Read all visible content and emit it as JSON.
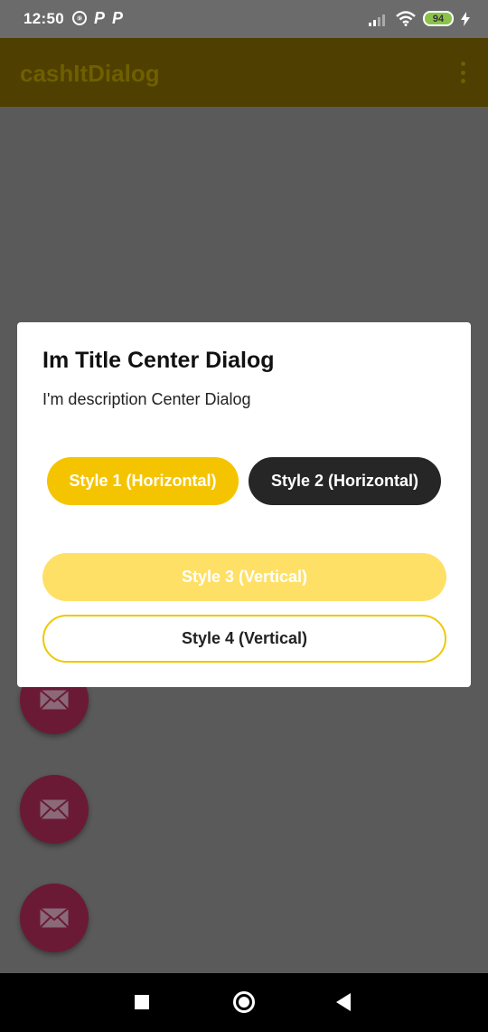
{
  "status_bar": {
    "time": "12:50",
    "battery": "94"
  },
  "app_bar": {
    "title": "cashItDialog"
  },
  "dialog": {
    "title": "Im Title Center Dialog",
    "description": "I'm description Center Dialog",
    "buttons": {
      "style1": "Style 1 (Horizontal)",
      "style2": "Style 2 (Horizontal)",
      "style3": "Style 3 (Vertical)",
      "style4": "Style 4 (Vertical)"
    }
  },
  "icons": {
    "fab": "mail-icon",
    "more": "more-vertical-icon",
    "nav": [
      "square-icon",
      "home-circle-icon",
      "back-triangle-icon"
    ]
  },
  "colors": {
    "primary": "#f5c400",
    "dark_button": "#262626",
    "fab": "#6b1a35",
    "scrim": "#5a5a5a"
  }
}
